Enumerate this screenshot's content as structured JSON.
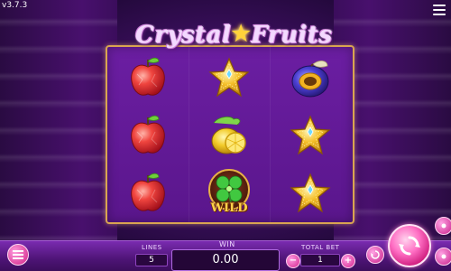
{
  "app": {
    "version": "v3.7.3",
    "title_part1": "Crystal",
    "title_star": "★",
    "title_part2": "Fruits"
  },
  "reels": [
    [
      "apple",
      "apple",
      "apple"
    ],
    [
      "star",
      "lemon",
      "wild"
    ],
    [
      "plum",
      "star",
      "star"
    ]
  ],
  "wild_label": "WILD",
  "controls": {
    "lines_label": "LINES",
    "lines_value": "5",
    "win_label": "WIN",
    "win_value": "0.00",
    "total_bet_label": "TOTAL BET",
    "total_bet_value": "1",
    "minus_symbol": "−",
    "plus_symbol": "+"
  },
  "icons": {
    "menu": "hamburger-icon",
    "spin": "refresh-arrows-icon",
    "autoplay": "autoplay-icon",
    "settings": "settings-icon"
  },
  "colors": {
    "frame": "#d9a451",
    "board": "#6b1ea2",
    "accent_pink": "#d4238e"
  }
}
